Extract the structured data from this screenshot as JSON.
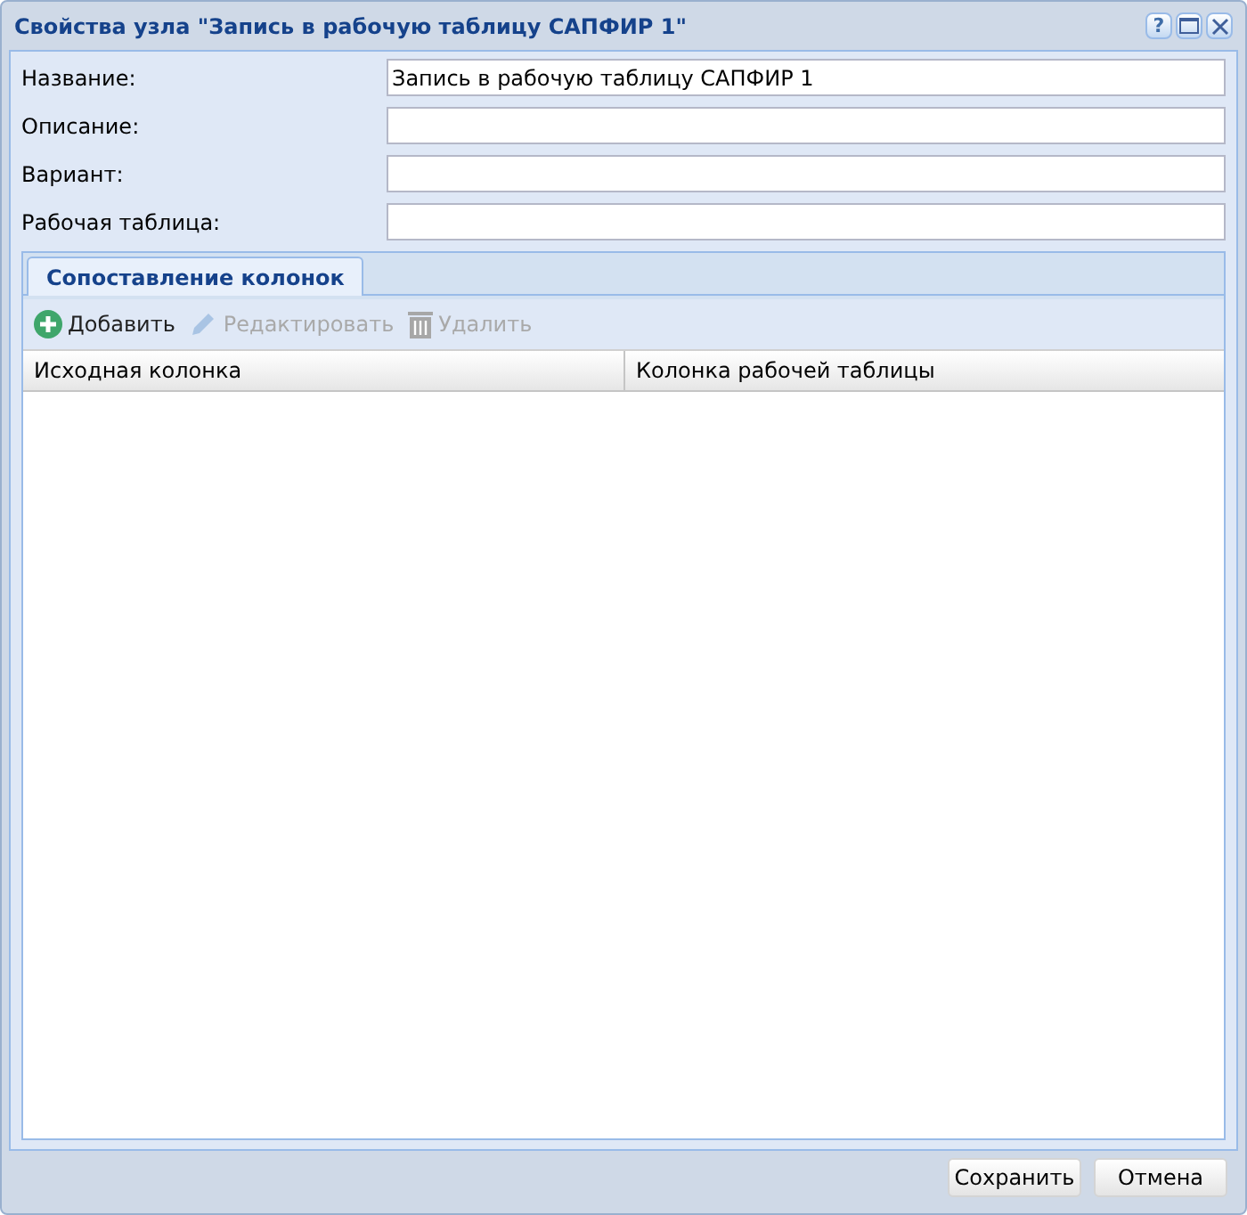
{
  "window": {
    "title": "Свойства узла \"Запись в рабочую таблицу САПФИР 1\"",
    "help": "?"
  },
  "fields": [
    {
      "label": "Название:",
      "value": "Запись в рабочую таблицу САПФИР 1"
    },
    {
      "label": "Описание:"
    },
    {
      "label": "Вариант:"
    },
    {
      "label": "Рабочая таблица:"
    }
  ],
  "tabs": [
    {
      "label": "Сопоставление колонок",
      "selected": true
    }
  ],
  "toolbar": [
    {
      "kind": "add",
      "label": "Добавить",
      "disabled": false
    },
    {
      "kind": "edit",
      "label": "Редактировать",
      "disabled": true
    },
    {
      "kind": "delete",
      "label": "Удалить",
      "disabled": true
    }
  ],
  "table": {
    "columns": [
      "Исходная колонка",
      "Колонка рабочей таблицы"
    ]
  },
  "buttons": [
    "Сохранить",
    "Отмена"
  ]
}
